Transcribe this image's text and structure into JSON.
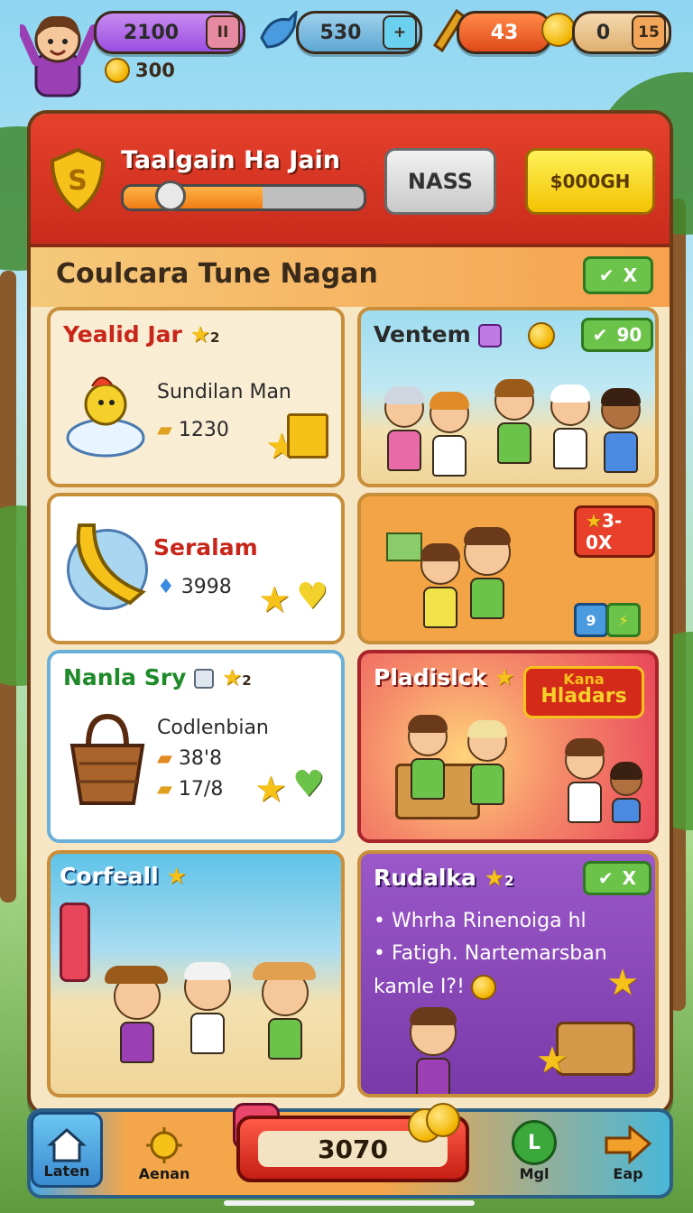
{
  "hud": {
    "gems": "2100",
    "gems_cap": "II",
    "fish": "530",
    "fish_add": "+",
    "energy": "43",
    "coins": "0",
    "coins_cap": "15",
    "sub_coins": "300"
  },
  "header": {
    "title": "Taalgain Ha Jain",
    "progress": 0.58,
    "btn_secondary": "NASS",
    "btn_primary": "$000GH"
  },
  "section": {
    "title": "Coulcara Tune Nagan",
    "tag_x": "X"
  },
  "cards": [
    {
      "title": "Yealid Jar",
      "badge": "2",
      "line1": "Sundilan Man",
      "line2": "1230"
    },
    {
      "title": "Ventem",
      "badge": "",
      "tag_value": "90"
    },
    {
      "title": "Seralam",
      "value": "3998"
    },
    {
      "tag": "3-0X",
      "small_btn": "9"
    },
    {
      "title": "Nanla Sry",
      "badge": "2",
      "line1": "Codlenbian",
      "line2": "38'8",
      "line3": "17/8"
    },
    {
      "title": "Pladislck",
      "banner_line1": "Kana",
      "banner_line2": "Hladars"
    },
    {
      "title": "Corfeall"
    },
    {
      "title": "Rudalka",
      "badge": "2",
      "tag_x": "X",
      "bullet1": "Whrha Rinenoiga hl",
      "bullet2": "Fatigh. Nartemarsban",
      "line3": "kamle I?!"
    }
  ],
  "bottom": {
    "nav1": "Laten",
    "nav2": "Aenan",
    "main_value": "3070",
    "nav3": "Mgl",
    "nav4": "Eap"
  }
}
